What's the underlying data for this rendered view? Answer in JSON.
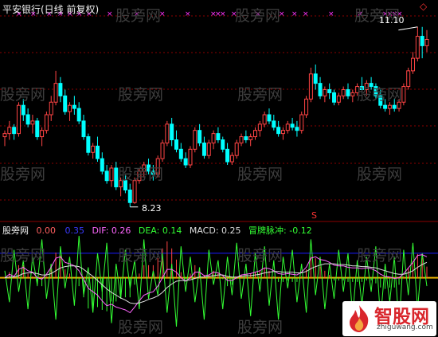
{
  "header": {
    "title": "平安银行(日线 前复权)"
  },
  "watermark": {
    "text": "股旁网"
  },
  "price_panel": {
    "high_marker": "11.10",
    "low_marker": "8.23",
    "flag_symbol": "S",
    "diamond_symbol": "◇"
  },
  "macd_panel": {
    "name": "股旁网",
    "v1": {
      "label": "",
      "value": "0.00",
      "color": "#ff5f5f"
    },
    "v2": {
      "label": "",
      "value": "0.35",
      "color": "#3a3aff"
    },
    "dif": {
      "label": "DIF: ",
      "value": "0.26",
      "color": "#ff66ff"
    },
    "dea": {
      "label": "DEA: ",
      "value": "0.14",
      "color": "#33ff33"
    },
    "macd": {
      "label": "MACD: ",
      "value": "0.25",
      "color": "#dddddd"
    },
    "signal": {
      "label": "冒牌脉冲: ",
      "value": "-0.12",
      "color": "#33ff33"
    }
  },
  "logo": {
    "text": "智股网",
    "url": "zhiguwang.com"
  },
  "colors": {
    "up": "#ff4444",
    "down": "#00ffff",
    "macd_green": "#33ff33",
    "dif_line": "#ff66ff",
    "dea_line": "#dddddd",
    "level_blue": "#1a1aff",
    "level_orange": "#e8b000",
    "grid": "#8b0000",
    "marker": "#ff33ff"
  },
  "chart_data": [
    {
      "type": "candlestick",
      "title": "平安银行(日线 前复权)",
      "series": [
        {
          "ohlc": [
            [
              9.35,
              9.45,
              9.2,
              9.4
            ],
            [
              9.4,
              9.6,
              9.3,
              9.5
            ],
            [
              9.5,
              9.55,
              9.3,
              9.4
            ],
            [
              9.4,
              9.9,
              9.35,
              9.85
            ],
            [
              9.85,
              9.95,
              9.6,
              9.7
            ],
            [
              9.7,
              9.8,
              9.5,
              9.55
            ],
            [
              9.55,
              9.7,
              9.4,
              9.6
            ],
            [
              9.6,
              9.65,
              9.3,
              9.35
            ],
            [
              9.35,
              9.5,
              9.2,
              9.45
            ],
            [
              9.45,
              9.75,
              9.4,
              9.7
            ],
            [
              9.7,
              10.0,
              9.6,
              9.9
            ],
            [
              9.9,
              10.4,
              9.85,
              10.2
            ],
            [
              10.2,
              10.3,
              9.9,
              10.0
            ],
            [
              10.0,
              10.1,
              9.7,
              9.75
            ],
            [
              9.75,
              9.9,
              9.6,
              9.85
            ],
            [
              9.85,
              10.0,
              9.7,
              9.8
            ],
            [
              9.8,
              9.9,
              9.55,
              9.6
            ],
            [
              9.6,
              9.7,
              9.3,
              9.35
            ],
            [
              9.35,
              9.4,
              9.05,
              9.1
            ],
            [
              9.1,
              9.25,
              9.0,
              9.2
            ],
            [
              9.2,
              9.35,
              8.95,
              9.0
            ],
            [
              9.0,
              9.1,
              8.75,
              8.8
            ],
            [
              8.8,
              8.9,
              8.6,
              8.65
            ],
            [
              8.65,
              8.9,
              8.55,
              8.85
            ],
            [
              8.85,
              8.95,
              8.5,
              8.55
            ],
            [
              8.55,
              8.7,
              8.4,
              8.65
            ],
            [
              8.65,
              8.75,
              8.45,
              8.5
            ],
            [
              8.5,
              8.6,
              8.23,
              8.3
            ],
            [
              8.3,
              8.7,
              8.28,
              8.65
            ],
            [
              8.65,
              8.85,
              8.6,
              8.8
            ],
            [
              8.8,
              8.95,
              8.7,
              8.9
            ],
            [
              8.9,
              9.0,
              8.75,
              8.8
            ],
            [
              8.8,
              8.9,
              8.65,
              8.75
            ],
            [
              8.75,
              9.05,
              8.7,
              9.0
            ],
            [
              9.0,
              9.3,
              8.95,
              9.25
            ],
            [
              9.25,
              9.6,
              9.2,
              9.55
            ],
            [
              9.55,
              9.65,
              9.2,
              9.3
            ],
            [
              9.3,
              9.45,
              9.1,
              9.15
            ],
            [
              9.15,
              9.25,
              8.95,
              9.0
            ],
            [
              9.0,
              9.1,
              8.85,
              8.9
            ],
            [
              8.9,
              9.2,
              8.85,
              9.15
            ],
            [
              9.15,
              9.5,
              9.1,
              9.45
            ],
            [
              9.45,
              9.55,
              9.2,
              9.25
            ],
            [
              9.25,
              9.35,
              9.0,
              9.05
            ],
            [
              9.05,
              9.3,
              9.0,
              9.25
            ],
            [
              9.25,
              9.45,
              9.15,
              9.4
            ],
            [
              9.4,
              9.5,
              9.25,
              9.3
            ],
            [
              9.3,
              9.35,
              9.1,
              9.15
            ],
            [
              9.15,
              9.25,
              8.9,
              8.95
            ],
            [
              8.95,
              9.1,
              8.9,
              9.05
            ],
            [
              9.05,
              9.3,
              9.0,
              9.25
            ],
            [
              9.25,
              9.4,
              9.2,
              9.35
            ],
            [
              9.35,
              9.45,
              9.25,
              9.3
            ],
            [
              9.3,
              9.4,
              9.2,
              9.35
            ],
            [
              9.35,
              9.5,
              9.3,
              9.45
            ],
            [
              9.45,
              9.6,
              9.35,
              9.55
            ],
            [
              9.55,
              9.75,
              9.5,
              9.7
            ],
            [
              9.7,
              9.8,
              9.55,
              9.6
            ],
            [
              9.6,
              9.7,
              9.45,
              9.5
            ],
            [
              9.5,
              9.6,
              9.35,
              9.4
            ],
            [
              9.4,
              9.5,
              9.3,
              9.45
            ],
            [
              9.45,
              9.6,
              9.4,
              9.55
            ],
            [
              9.55,
              9.65,
              9.45,
              9.5
            ],
            [
              9.5,
              9.6,
              9.35,
              9.45
            ],
            [
              9.45,
              9.75,
              9.4,
              9.7
            ],
            [
              9.7,
              10.0,
              9.65,
              9.95
            ],
            [
              9.95,
              10.45,
              9.9,
              10.35
            ],
            [
              10.35,
              10.5,
              10.1,
              10.2
            ],
            [
              10.2,
              10.3,
              9.95,
              10.0
            ],
            [
              10.0,
              10.15,
              9.9,
              10.1
            ],
            [
              10.1,
              10.2,
              9.95,
              10.05
            ],
            [
              10.05,
              10.1,
              9.85,
              9.9
            ],
            [
              9.9,
              10.05,
              9.85,
              10.0
            ],
            [
              10.0,
              10.15,
              9.95,
              10.1
            ],
            [
              10.1,
              10.2,
              9.95,
              10.0
            ],
            [
              10.0,
              10.1,
              9.9,
              10.05
            ],
            [
              10.05,
              10.2,
              10.0,
              10.15
            ],
            [
              10.15,
              10.3,
              10.05,
              10.1
            ],
            [
              10.1,
              10.25,
              10.0,
              10.2
            ],
            [
              10.2,
              10.3,
              10.1,
              10.15
            ],
            [
              10.15,
              10.2,
              9.95,
              10.0
            ],
            [
              10.0,
              10.1,
              9.8,
              9.85
            ],
            [
              9.85,
              9.95,
              9.75,
              9.8
            ],
            [
              9.8,
              9.9,
              9.7,
              9.85
            ],
            [
              9.85,
              9.95,
              9.75,
              9.8
            ],
            [
              9.8,
              9.95,
              9.75,
              9.9
            ],
            [
              9.9,
              10.2,
              9.85,
              10.15
            ],
            [
              10.15,
              10.45,
              10.1,
              10.4
            ],
            [
              10.4,
              10.7,
              10.35,
              10.6
            ],
            [
              10.6,
              11.1,
              10.55,
              10.95
            ],
            [
              10.95,
              11.1,
              10.6,
              10.8
            ],
            [
              10.8,
              11.05,
              10.7,
              10.9
            ]
          ]
        }
      ],
      "annotations": [
        "11.10",
        "8.23"
      ]
    },
    {
      "type": "line",
      "title": "股旁网",
      "series": [
        {
          "name": "DIF",
          "values": [
            0.0,
            0.05,
            0.02,
            0.12,
            0.15,
            0.1,
            0.08,
            0.0,
            -0.02,
            0.05,
            0.15,
            0.28,
            0.3,
            0.22,
            0.2,
            0.17,
            0.1,
            -0.02,
            -0.15,
            -0.2,
            -0.25,
            -0.33,
            -0.4,
            -0.38,
            -0.42,
            -0.44,
            -0.46,
            -0.5,
            -0.42,
            -0.33,
            -0.25,
            -0.22,
            -0.2,
            -0.12,
            0.0,
            0.12,
            0.12,
            0.08,
            0.0,
            -0.05,
            0.0,
            0.08,
            0.08,
            0.03,
            0.04,
            0.08,
            0.07,
            0.03,
            -0.04,
            -0.04,
            0.0,
            0.04,
            0.05,
            0.06,
            0.08,
            0.1,
            0.14,
            0.13,
            0.1,
            0.06,
            0.05,
            0.06,
            0.05,
            0.04,
            0.08,
            0.15,
            0.28,
            0.3,
            0.26,
            0.25,
            0.22,
            0.18,
            0.17,
            0.17,
            0.15,
            0.14,
            0.14,
            0.13,
            0.14,
            0.13,
            0.1,
            0.05,
            0.02,
            0.01,
            -0.01,
            0.0,
            0.06,
            0.14,
            0.22,
            0.32,
            0.33,
            0.3
          ]
        },
        {
          "name": "DEA",
          "values": [
            0.0,
            0.01,
            0.01,
            0.03,
            0.06,
            0.07,
            0.07,
            0.06,
            0.04,
            0.04,
            0.06,
            0.1,
            0.14,
            0.16,
            0.17,
            0.17,
            0.16,
            0.12,
            0.07,
            0.02,
            -0.04,
            -0.1,
            -0.16,
            -0.21,
            -0.25,
            -0.29,
            -0.32,
            -0.36,
            -0.37,
            -0.36,
            -0.34,
            -0.31,
            -0.29,
            -0.26,
            -0.21,
            -0.14,
            -0.09,
            -0.05,
            -0.04,
            -0.04,
            -0.03,
            -0.01,
            0.01,
            0.01,
            0.02,
            0.03,
            0.04,
            0.04,
            0.02,
            0.01,
            0.01,
            0.02,
            0.03,
            0.03,
            0.04,
            0.05,
            0.07,
            0.08,
            0.09,
            0.09,
            0.08,
            0.08,
            0.08,
            0.07,
            0.07,
            0.09,
            0.13,
            0.16,
            0.18,
            0.2,
            0.2,
            0.2,
            0.19,
            0.19,
            0.18,
            0.17,
            0.17,
            0.16,
            0.16,
            0.15,
            0.14,
            0.12,
            0.1,
            0.08,
            0.06,
            0.05,
            0.05,
            0.07,
            0.1,
            0.15,
            0.19,
            0.22
          ]
        },
        {
          "name": "冒牌脉冲",
          "values": [
            0.1,
            -0.35,
            0.4,
            -0.2,
            0.25,
            -0.45,
            0.3,
            -0.1,
            0.55,
            -0.3,
            0.2,
            -0.6,
            0.45,
            -0.15,
            0.3,
            -0.4,
            0.6,
            -0.25,
            0.15,
            -0.5,
            0.35,
            -0.2,
            0.5,
            -0.65,
            0.2,
            -0.3,
            0.4,
            -0.15,
            0.25,
            -0.45,
            0.55,
            -0.3,
            0.1,
            -0.25,
            0.35,
            -0.5,
            0.2,
            -0.7,
            0.45,
            -0.2,
            0.3,
            -0.35,
            0.15,
            -0.6,
            0.4,
            -0.1,
            0.25,
            -0.45,
            0.3,
            -0.25,
            0.5,
            -0.3,
            0.2,
            -0.55,
            0.35,
            -0.2,
            0.45,
            -0.4,
            0.25,
            -0.6,
            0.3,
            -0.15,
            0.4,
            -0.35,
            0.2,
            -0.5,
            0.55,
            -0.25,
            0.3,
            -0.45,
            0.2,
            -0.3,
            0.4,
            -0.2,
            0.35,
            -0.55,
            0.25,
            -0.4,
            0.3,
            -0.2,
            0.45,
            -0.6,
            0.2,
            -0.35,
            0.3,
            -0.7,
            0.4,
            -0.25,
            0.5,
            -0.45,
            0.35,
            -0.12
          ]
        }
      ],
      "levels": [
        0.35,
        0.0
      ]
    }
  ]
}
